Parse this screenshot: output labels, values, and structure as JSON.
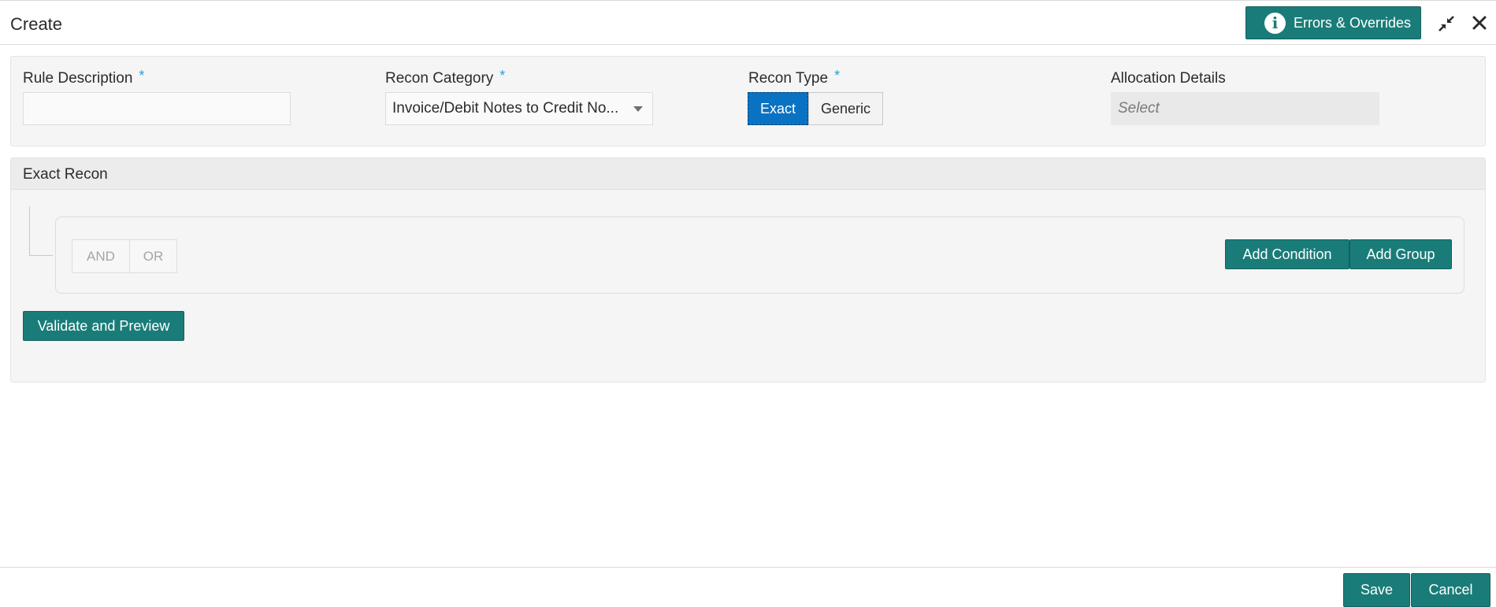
{
  "header": {
    "title": "Create",
    "errors_button": {
      "label": "Errors & Overrides",
      "icon": "info-icon"
    },
    "collapse_icon": "collapse-arrows-icon",
    "close_icon": "close-icon"
  },
  "fields": {
    "rule_description": {
      "label": "Rule Description",
      "required_mark": "*",
      "value": ""
    },
    "recon_category": {
      "label": "Recon Category",
      "required_mark": "*",
      "selected": "Invoice/Debit Notes to Credit No..."
    },
    "recon_type": {
      "label": "Recon Type",
      "required_mark": "*",
      "options": [
        "Exact",
        "Generic"
      ],
      "selected": "Exact"
    },
    "allocation_details": {
      "label": "Allocation Details",
      "placeholder": "Select"
    }
  },
  "exact_recon": {
    "title": "Exact Recon",
    "operators": [
      "AND",
      "OR"
    ],
    "add_condition": "Add Condition",
    "add_group": "Add Group",
    "validate_preview": "Validate and Preview"
  },
  "footer": {
    "save": "Save",
    "cancel": "Cancel"
  },
  "colors": {
    "teal": "#1a7c78",
    "selected_blue": "#0a72c2",
    "required_asterisk": "#2a9fd6"
  }
}
